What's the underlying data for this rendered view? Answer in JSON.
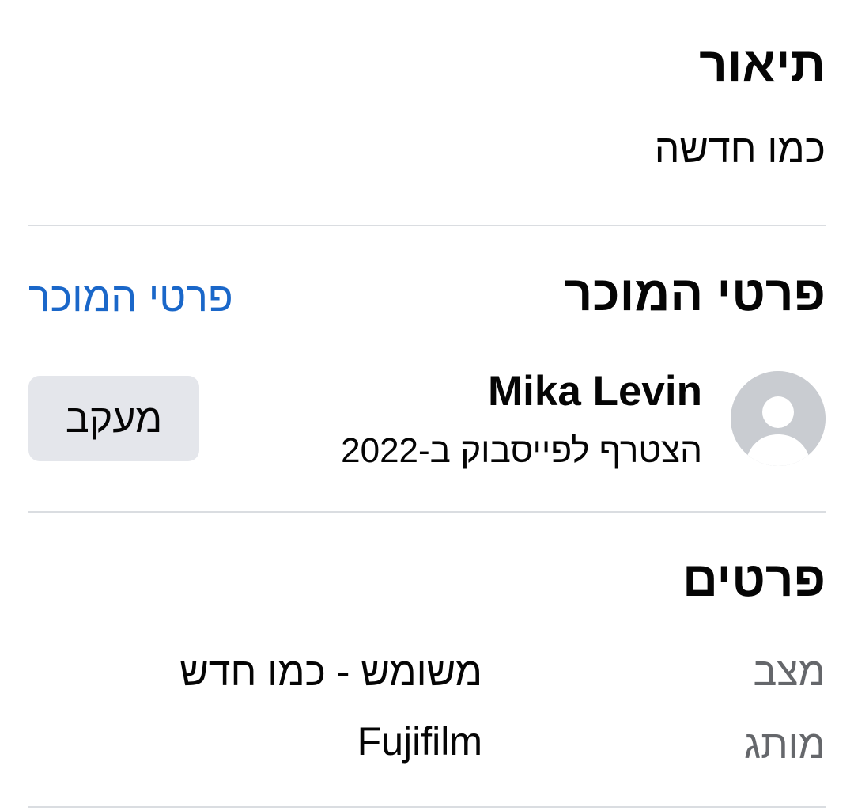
{
  "description": {
    "title": "תיאור",
    "text": "כמו חדשה"
  },
  "seller": {
    "title": "פרטי המוכר",
    "link_label": "פרטי המוכר",
    "name": "Mika Levin",
    "joined": "הצטרף לפייסבוק ב-2022",
    "follow_label": "מעקב",
    "avatar_icon": "default-avatar-icon"
  },
  "details": {
    "title": "פרטים",
    "rows": [
      {
        "label": "מצב",
        "value": "משומש - כמו חדש"
      },
      {
        "label": "מותג",
        "value": "Fujifilm"
      }
    ]
  },
  "colors": {
    "link": "#1a67c9",
    "button_bg": "#e4e6eb",
    "divider": "#dadde1",
    "label": "#65676b",
    "text": "#050505"
  }
}
